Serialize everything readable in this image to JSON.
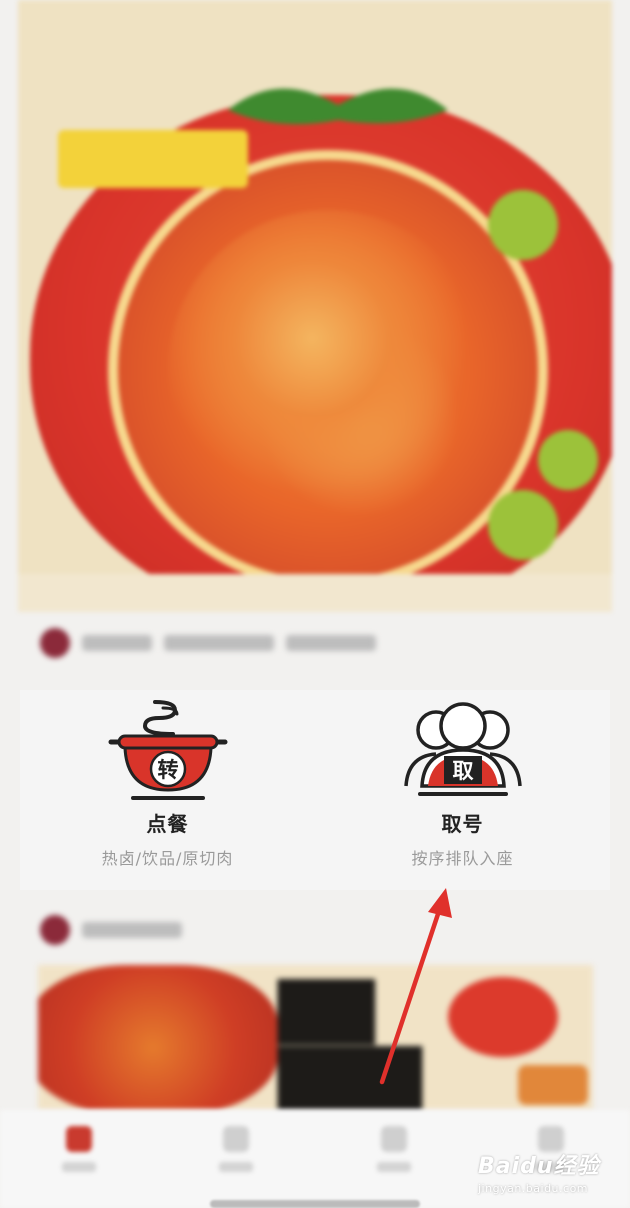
{
  "actions": [
    {
      "icon": "hotpot-pot-icon",
      "icon_char": "转",
      "label": "点餐",
      "subtitle": "热卤/饮品/原切肉"
    },
    {
      "icon": "queue-people-icon",
      "icon_char": "取",
      "label": "取号",
      "subtitle": "按序排队入座"
    }
  ],
  "colors": {
    "accent_red": "#d9342a",
    "arrow_red": "#e0302b",
    "label_dark": "#222222",
    "subtitle_gray": "#9a9a9a"
  },
  "watermark": {
    "main": "Baidu经验",
    "sub": "jingyan.baidu.com"
  }
}
